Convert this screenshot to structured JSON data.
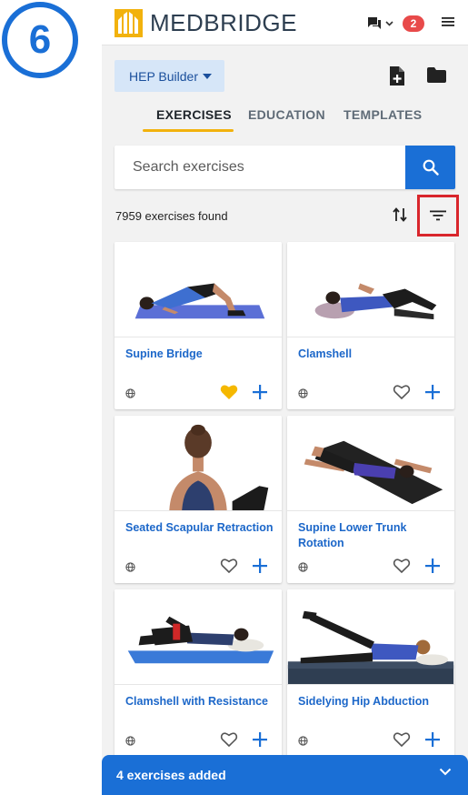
{
  "step_number": "6",
  "brand": {
    "name": "MEDBRIDGE",
    "accent": "#f2b20d",
    "primary": "#1a6fd6"
  },
  "header": {
    "notification_count": "2"
  },
  "toolbar": {
    "hep_builder_label": "HEP Builder"
  },
  "tabs": [
    {
      "label": "EXERCISES",
      "active": true
    },
    {
      "label": "EDUCATION",
      "active": false
    },
    {
      "label": "TEMPLATES",
      "active": false
    }
  ],
  "search": {
    "placeholder": "Search exercises",
    "value": ""
  },
  "results": {
    "count_text": "7959 exercises found"
  },
  "exercises": [
    {
      "title": "Supine Bridge",
      "favorited": true
    },
    {
      "title": "Clamshell",
      "favorited": false
    },
    {
      "title": "Seated Scapular Retraction",
      "favorited": false
    },
    {
      "title": "Supine Lower Trunk Rotation",
      "favorited": false
    },
    {
      "title": "Clamshell with Resistance",
      "favorited": false
    },
    {
      "title": "Sidelying Hip Abduction",
      "favorited": false
    }
  ],
  "bottom_bar": {
    "label": "4 exercises added"
  }
}
